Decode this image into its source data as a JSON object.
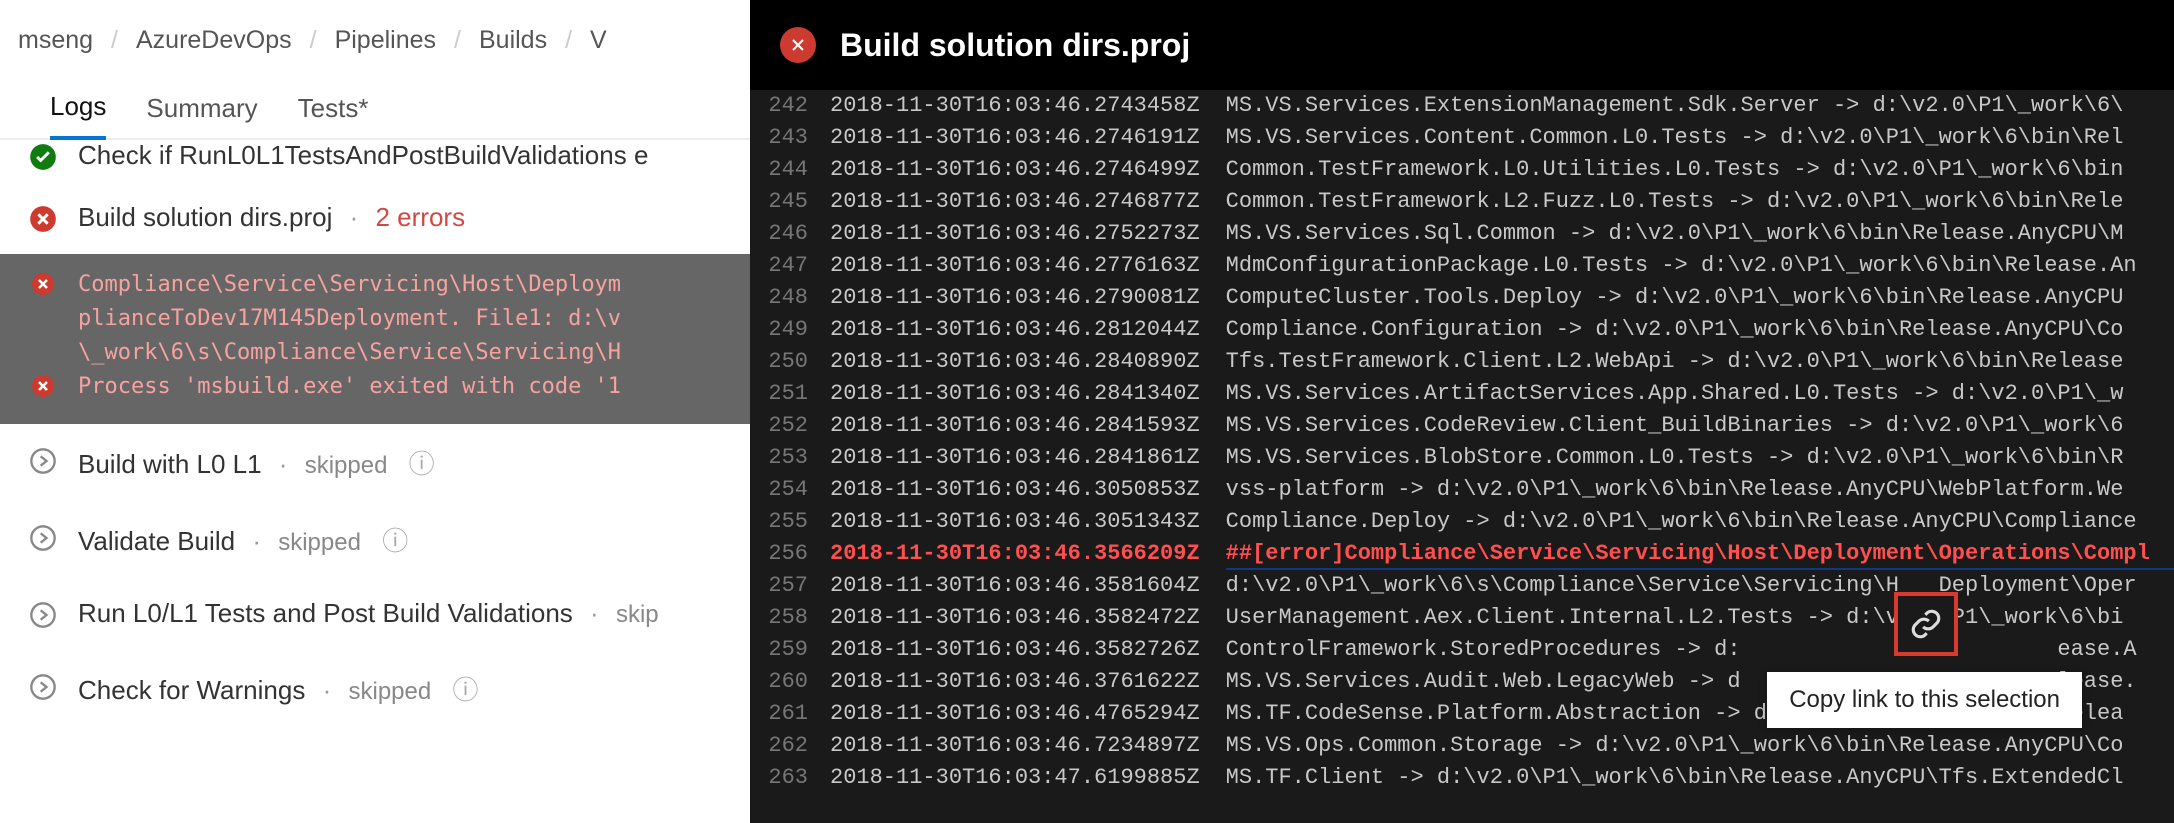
{
  "breadcrumb": [
    "mseng",
    "AzureDevOps",
    "Pipelines",
    "Builds",
    "V"
  ],
  "tabs": {
    "logs": "Logs",
    "summary": "Summary",
    "tests": "Tests*"
  },
  "panel": {
    "title": "Build solution dirs.proj"
  },
  "tooltip": "Copy link to this selection",
  "tasks": {
    "check": "Check if RunL0L1TestsAndPostBuildValidations e",
    "buildsol": "Build solution dirs.proj",
    "buildsol_err": "2 errors",
    "e1": "Compliance\\Service\\Servicing\\Host\\Deploym\nplianceToDev17M145Deployment. File1: d:\\v\n\\_work\\6\\s\\Compliance\\Service\\Servicing\\H",
    "e2": "Process 'msbuild.exe' exited with code '1",
    "bl0": "Build with L0 L1",
    "bl0_s": "skipped",
    "vb": "Validate Build",
    "vb_s": "skipped",
    "rl": "Run L0/L1 Tests and Post Build Validations",
    "rl_s": "skip",
    "cw": "Check for Warnings",
    "cw_s": "skipped"
  },
  "log_lines": [
    {
      "n": 242,
      "ts": "2018-11-30T16:03:46.2743458Z",
      "m": "MS.VS.Services.ExtensionManagement.Sdk.Server -> d:\\v2.0\\P1\\_work\\6\\"
    },
    {
      "n": 243,
      "ts": "2018-11-30T16:03:46.2746191Z",
      "m": "MS.VS.Services.Content.Common.L0.Tests -> d:\\v2.0\\P1\\_work\\6\\bin\\Rel"
    },
    {
      "n": 244,
      "ts": "2018-11-30T16:03:46.2746499Z",
      "m": "Common.TestFramework.L0.Utilities.L0.Tests -> d:\\v2.0\\P1\\_work\\6\\bin"
    },
    {
      "n": 245,
      "ts": "2018-11-30T16:03:46.2746877Z",
      "m": "Common.TestFramework.L2.Fuzz.L0.Tests -> d:\\v2.0\\P1\\_work\\6\\bin\\Rele"
    },
    {
      "n": 246,
      "ts": "2018-11-30T16:03:46.2752273Z",
      "m": "MS.VS.Services.Sql.Common -> d:\\v2.0\\P1\\_work\\6\\bin\\Release.AnyCPU\\M"
    },
    {
      "n": 247,
      "ts": "2018-11-30T16:03:46.2776163Z",
      "m": "MdmConfigurationPackage.L0.Tests -> d:\\v2.0\\P1\\_work\\6\\bin\\Release.An"
    },
    {
      "n": 248,
      "ts": "2018-11-30T16:03:46.2790081Z",
      "m": "ComputeCluster.Tools.Deploy -> d:\\v2.0\\P1\\_work\\6\\bin\\Release.AnyCPU"
    },
    {
      "n": 249,
      "ts": "2018-11-30T16:03:46.2812044Z",
      "m": "Compliance.Configuration -> d:\\v2.0\\P1\\_work\\6\\bin\\Release.AnyCPU\\Co"
    },
    {
      "n": 250,
      "ts": "2018-11-30T16:03:46.2840890Z",
      "m": "Tfs.TestFramework.Client.L2.WebApi -> d:\\v2.0\\P1\\_work\\6\\bin\\Release"
    },
    {
      "n": 251,
      "ts": "2018-11-30T16:03:46.2841340Z",
      "m": "MS.VS.Services.ArtifactServices.App.Shared.L0.Tests -> d:\\v2.0\\P1\\_w"
    },
    {
      "n": 252,
      "ts": "2018-11-30T16:03:46.2841593Z",
      "m": "MS.VS.Services.CodeReview.Client_BuildBinaries -> d:\\v2.0\\P1\\_work\\6"
    },
    {
      "n": 253,
      "ts": "2018-11-30T16:03:46.2841861Z",
      "m": "MS.VS.Services.BlobStore.Common.L0.Tests -> d:\\v2.0\\P1\\_work\\6\\bin\\R"
    },
    {
      "n": 254,
      "ts": "2018-11-30T16:03:46.3050853Z",
      "m": "vss-platform -> d:\\v2.0\\P1\\_work\\6\\bin\\Release.AnyCPU\\WebPlatform.We"
    },
    {
      "n": 255,
      "ts": "2018-11-30T16:03:46.3051343Z",
      "m": "Compliance.Deploy -> d:\\v2.0\\P1\\_work\\6\\bin\\Release.AnyCPU\\Compliance"
    },
    {
      "n": 256,
      "ts": "2018-11-30T16:03:46.3566209Z",
      "m": "##[error]Compliance\\Service\\Servicing\\Host\\Deployment\\Operations\\Compl",
      "err": true
    },
    {
      "n": 257,
      "ts": "2018-11-30T16:03:46.3581604Z",
      "m": "d:\\v2.0\\P1\\_work\\6\\s\\Compliance\\Service\\Servicing\\H   Deployment\\Oper"
    },
    {
      "n": 258,
      "ts": "2018-11-30T16:03:46.3582472Z",
      "m": "UserManagement.Aex.Client.Internal.L2.Tests -> d:\\v2.0\\P1\\_work\\6\\bi"
    },
    {
      "n": 259,
      "ts": "2018-11-30T16:03:46.3582726Z",
      "m": "ControlFramework.StoredProcedures -> d:                        ease.A"
    },
    {
      "n": 260,
      "ts": "2018-11-30T16:03:46.3761622Z",
      "m": "MS.VS.Services.Audit.Web.LegacyWeb -> d                        lease."
    },
    {
      "n": 261,
      "ts": "2018-11-30T16:03:46.4765294Z",
      "m": "MS.TF.CodeSense.Platform.Abstraction -> d:\\v2.0\\P1\\_work\\6\\bin\\Relea"
    },
    {
      "n": 262,
      "ts": "2018-11-30T16:03:46.7234897Z",
      "m": "MS.VS.Ops.Common.Storage -> d:\\v2.0\\P1\\_work\\6\\bin\\Release.AnyCPU\\Co"
    },
    {
      "n": 263,
      "ts": "2018-11-30T16:03:47.6199885Z",
      "m": "MS.TF.Client -> d:\\v2.0\\P1\\_work\\6\\bin\\Release.AnyCPU\\Tfs.ExtendedCl"
    }
  ]
}
